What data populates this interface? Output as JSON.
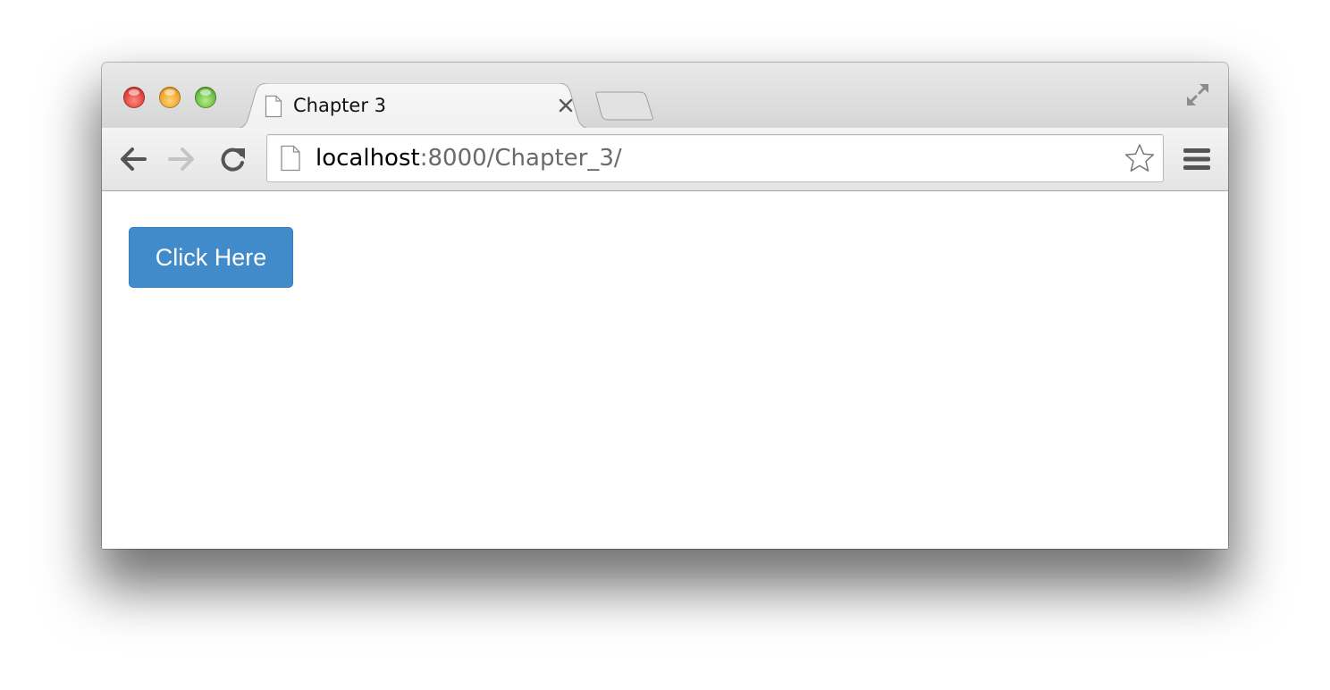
{
  "browser": {
    "tab": {
      "title": "Chapter 3",
      "icon": "document-icon",
      "close_icon": "close-icon"
    },
    "new_tab_icon": "new-tab-icon",
    "toolbar": {
      "back_icon": "arrow-left-icon",
      "forward_icon": "arrow-right-icon",
      "forward_enabled": false,
      "reload_icon": "reload-icon",
      "menu_icon": "hamburger-menu-icon"
    },
    "address_bar": {
      "page_icon": "document-icon",
      "url_host": "localhost",
      "url_rest": ":8000/Chapter_3/",
      "bookmark_icon": "star-icon"
    }
  },
  "page": {
    "button_label": "Click Here"
  },
  "colors": {
    "button_bg": "#428bca",
    "button_text": "#ffffff",
    "url_secondary": "#6a6a6a"
  }
}
